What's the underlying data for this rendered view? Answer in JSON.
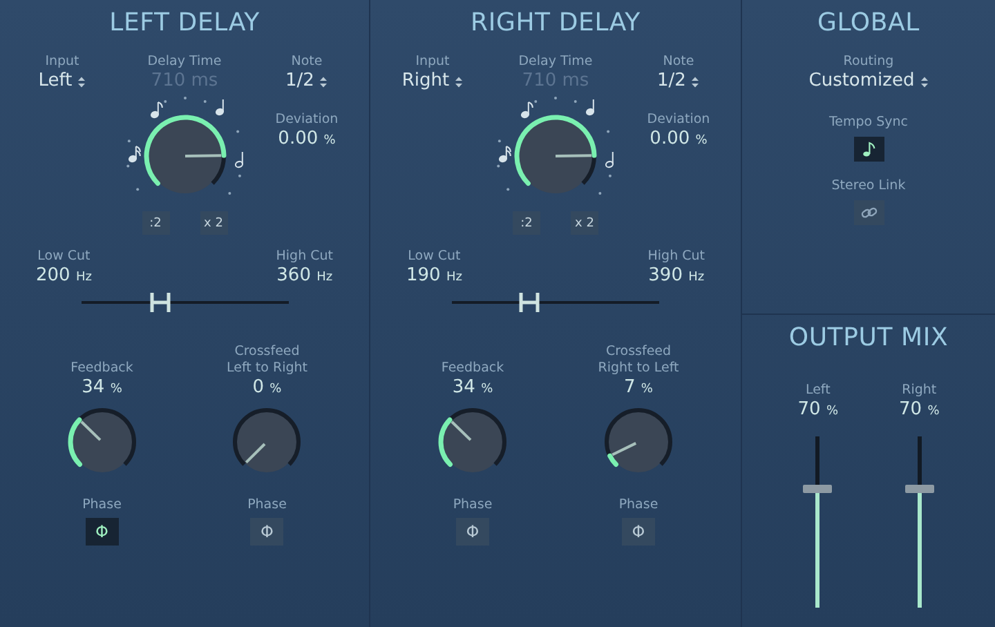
{
  "left_delay": {
    "title": "LEFT DELAY",
    "input": {
      "label": "Input",
      "value": "Left"
    },
    "delay_time": {
      "label": "Delay Time",
      "value": "710 ms",
      "disabled": true
    },
    "note": {
      "label": "Note",
      "value": "1/2"
    },
    "deviation": {
      "label": "Deviation",
      "value": "0.00",
      "unit": "%"
    },
    "divide_button": ":2",
    "multiply_button": "x 2",
    "low_cut": {
      "label": "Low Cut",
      "value": "200",
      "unit": "Hz"
    },
    "high_cut": {
      "label": "High Cut",
      "value": "360",
      "unit": "Hz"
    },
    "cut_slider": {
      "level": 0.38
    },
    "feedback": {
      "label": "Feedback",
      "value": "34",
      "unit": "%"
    },
    "crossfeed": {
      "label": "Crossfeed",
      "sublabel": "Left to Right",
      "value": "0",
      "unit": "%"
    },
    "phase": [
      {
        "label": "Phase",
        "symbol": "Φ",
        "on": true
      },
      {
        "label": "Phase",
        "symbol": "Φ",
        "on": false
      }
    ]
  },
  "right_delay": {
    "title": "RIGHT DELAY",
    "input": {
      "label": "Input",
      "value": "Right"
    },
    "delay_time": {
      "label": "Delay Time",
      "value": "710 ms",
      "disabled": true
    },
    "note": {
      "label": "Note",
      "value": "1/2"
    },
    "deviation": {
      "label": "Deviation",
      "value": "0.00",
      "unit": "%"
    },
    "divide_button": ":2",
    "multiply_button": "x 2",
    "low_cut": {
      "label": "Low Cut",
      "value": "190",
      "unit": "Hz"
    },
    "high_cut": {
      "label": "High Cut",
      "value": "390",
      "unit": "Hz"
    },
    "cut_slider": {
      "level": 0.37
    },
    "feedback": {
      "label": "Feedback",
      "value": "34",
      "unit": "%"
    },
    "crossfeed": {
      "label": "Crossfeed",
      "sublabel": "Right to Left",
      "value": "7",
      "unit": "%"
    },
    "phase": [
      {
        "label": "Phase",
        "symbol": "Φ",
        "on": false
      },
      {
        "label": "Phase",
        "symbol": "Φ",
        "on": false
      }
    ]
  },
  "global": {
    "title": "GLOBAL",
    "routing": {
      "label": "Routing",
      "value": "Customized"
    },
    "tempo_sync": {
      "label": "Tempo Sync",
      "on": true
    },
    "stereo_link": {
      "label": "Stereo Link",
      "on": false
    }
  },
  "output_mix": {
    "title": "OUTPUT MIX",
    "channels": [
      {
        "label": "Left",
        "value": "70",
        "unit": "%",
        "level": 0.7
      },
      {
        "label": "Right",
        "value": "70",
        "unit": "%",
        "level": 0.7
      }
    ]
  }
}
